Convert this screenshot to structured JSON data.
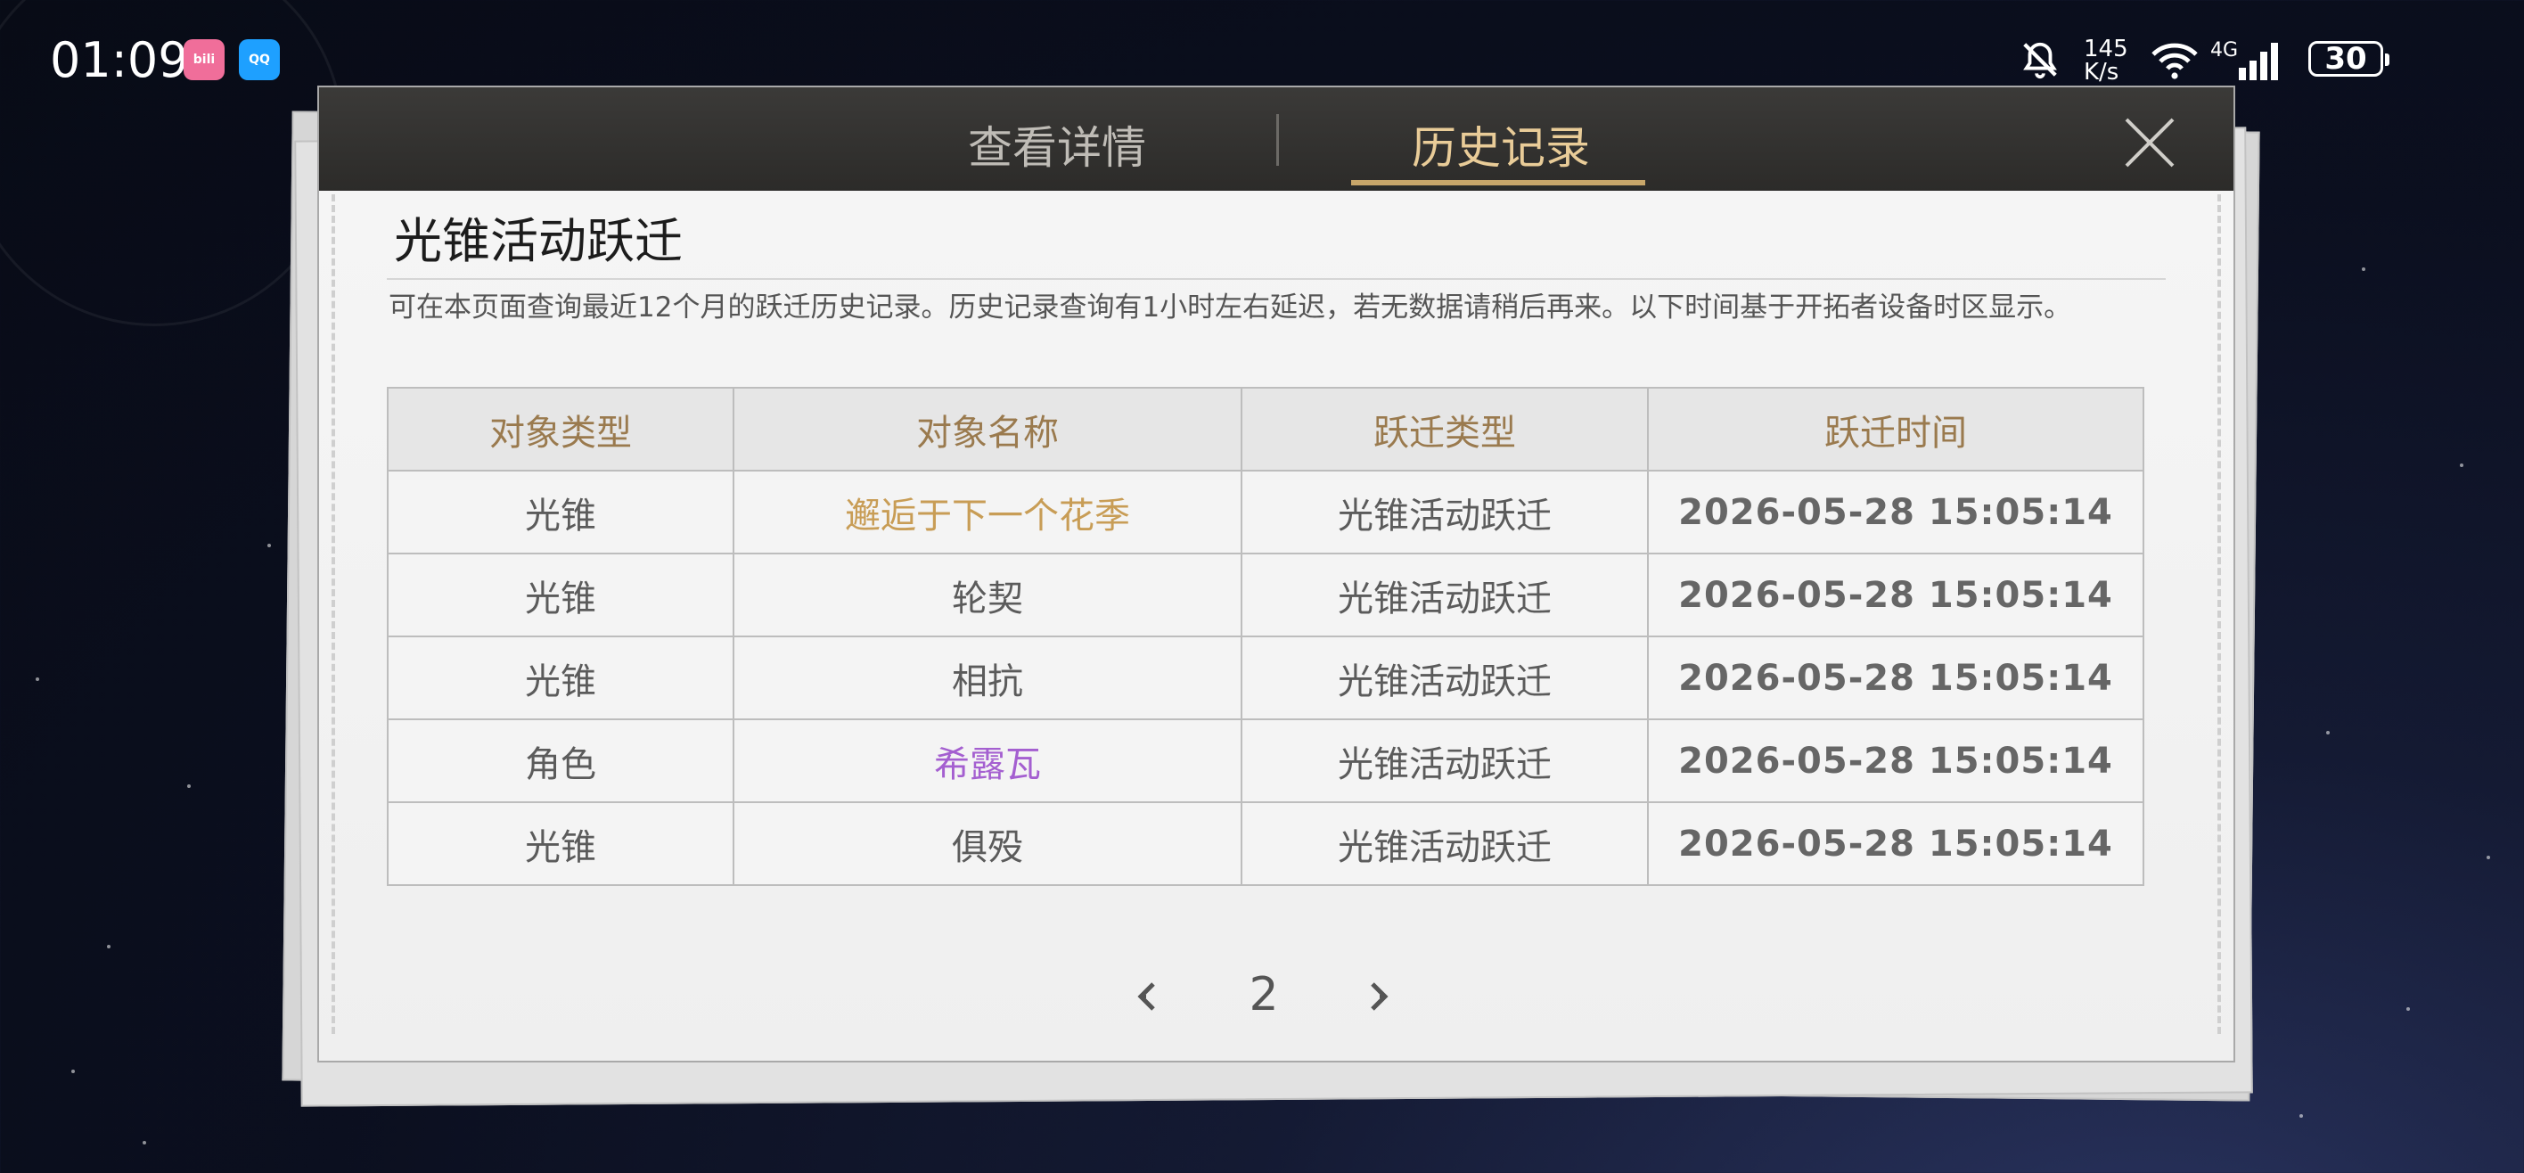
{
  "status_bar": {
    "time": "01:09",
    "speed_value": "145",
    "speed_unit": "K/s",
    "network": "4G",
    "battery": "30",
    "icons": [
      "bilibili-app-icon",
      "qq-app-icon",
      "mute-icon",
      "wifi-icon",
      "signal-icon",
      "battery-icon"
    ]
  },
  "tabs": {
    "details": "查看详情",
    "history": "历史记录",
    "active": "history"
  },
  "page": {
    "title": "光锥活动跃迁",
    "description": "可在本页面查询最近12个月的跃迁历史记录。历史记录查询有1小时左右延迟，若无数据请稍后再来。以下时间基于开拓者设备时区显示。"
  },
  "table": {
    "headers": [
      "对象类型",
      "对象名称",
      "跃迁类型",
      "跃迁时间"
    ],
    "rows": [
      {
        "type": "光锥",
        "name": "邂逅于下一个花季",
        "warp": "光锥活动跃迁",
        "time": "2026-05-28 15:05:14",
        "rarity": "4-star",
        "color": "#c89d56"
      },
      {
        "type": "光锥",
        "name": "轮契",
        "warp": "光锥活动跃迁",
        "time": "2026-05-28 15:05:14",
        "rarity": "3-star",
        "color": "#5b5b5b"
      },
      {
        "type": "光锥",
        "name": "相抗",
        "warp": "光锥活动跃迁",
        "time": "2026-05-28 15:05:14",
        "rarity": "3-star",
        "color": "#5b5b5b"
      },
      {
        "type": "角色",
        "name": "希露瓦",
        "warp": "光锥活动跃迁",
        "time": "2026-05-28 15:05:14",
        "rarity": "4-star",
        "color": "#a45fd0"
      },
      {
        "type": "光锥",
        "name": "俱殁",
        "warp": "光锥活动跃迁",
        "time": "2026-05-28 15:05:14",
        "rarity": "3-star",
        "color": "#5b5b5b"
      }
    ]
  },
  "pagination": {
    "current_page": "2"
  },
  "colors": {
    "tab_active": "#e9cc98",
    "tab_inactive": "#bfbcb6",
    "header_text": "#9a7a4e",
    "accent_underline": "#c8a66a"
  }
}
